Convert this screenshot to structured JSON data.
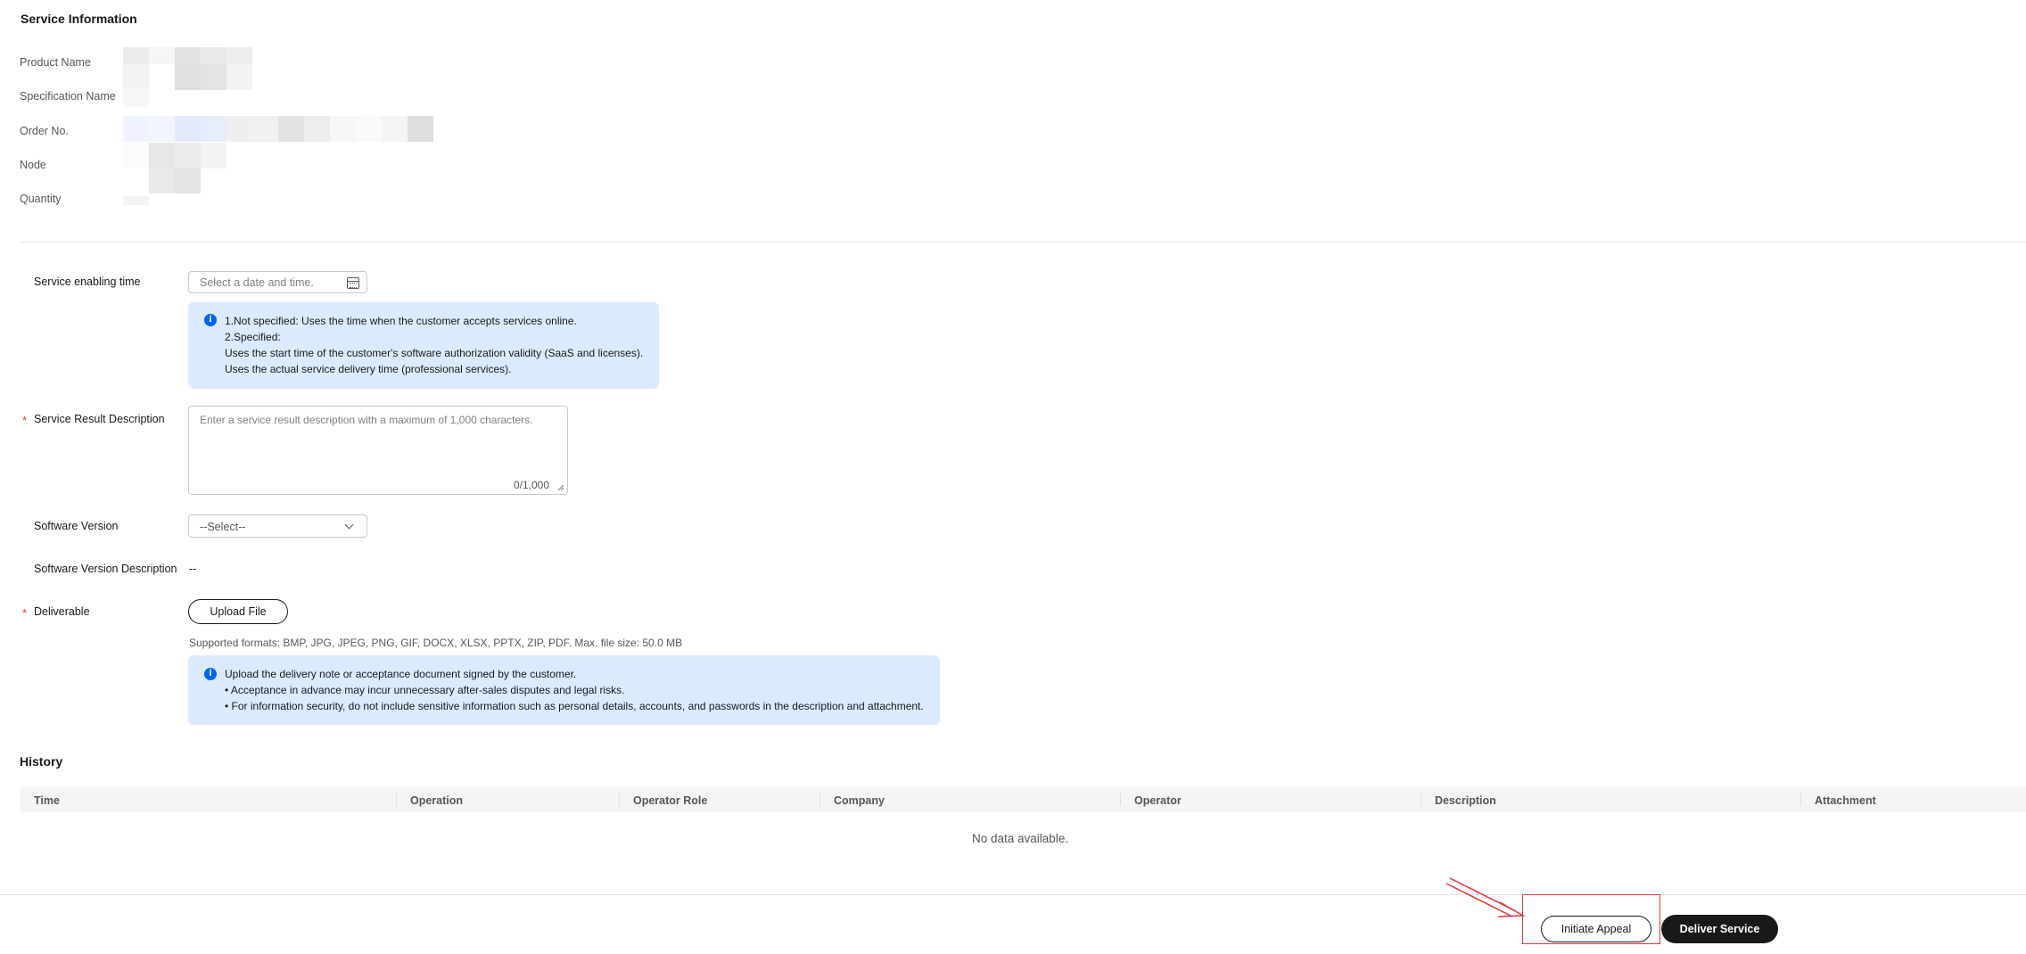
{
  "service_info": {
    "title": "Service Information",
    "fields": [
      {
        "label": "Product Name"
      },
      {
        "label": "Specification Name"
      },
      {
        "label": "Order No."
      },
      {
        "label": "Node"
      },
      {
        "label": "Quantity"
      }
    ]
  },
  "form": {
    "enabling_time": {
      "label": "Service enabling time",
      "placeholder": "Select a date and time."
    },
    "enabling_info": {
      "lines": [
        "1.Not specified: Uses the time when the customer accepts services online.",
        "2.Specified:",
        "Uses the start time of the customer's software authorization validity (SaaS and licenses).",
        "Uses the actual service delivery time (professional services)."
      ]
    },
    "result_description": {
      "required_mark": "*",
      "label": "Service Result Description",
      "placeholder": "Enter a service result description with a maximum of 1,000 characters.",
      "counter": "0/1,000"
    },
    "software_version": {
      "label": "Software Version",
      "selected": "--Select--"
    },
    "software_version_description": {
      "label": "Software Version Description",
      "value": "--"
    },
    "deliverable": {
      "required_mark": "*",
      "label": "Deliverable",
      "upload_label": "Upload File",
      "formats": "Supported formats: BMP, JPG, JPEG, PNG, GIF, DOCX, XLSX, PPTX, ZIP, PDF. Max. file size: 50.0 MB"
    },
    "deliverable_info": {
      "lines": [
        "Upload the delivery note or acceptance document signed by the customer.",
        "• Acceptance in advance may incur unnecessary after-sales disputes and legal risks.",
        "• For information security, do not include sensitive information such as personal details, accounts, and passwords in the description and attachment."
      ]
    }
  },
  "history": {
    "title": "History",
    "columns": [
      "Time",
      "Operation",
      "Operator Role",
      "Company",
      "Operator",
      "Description",
      "Attachment"
    ],
    "empty_text": "No data available."
  },
  "footer": {
    "appeal_label": "Initiate Appeal",
    "deliver_label": "Deliver Service"
  },
  "colors": {
    "accent": "#0062ff",
    "danger": "#e1383a",
    "primary_button": "#191919",
    "info_bg": "#dbeaff"
  }
}
